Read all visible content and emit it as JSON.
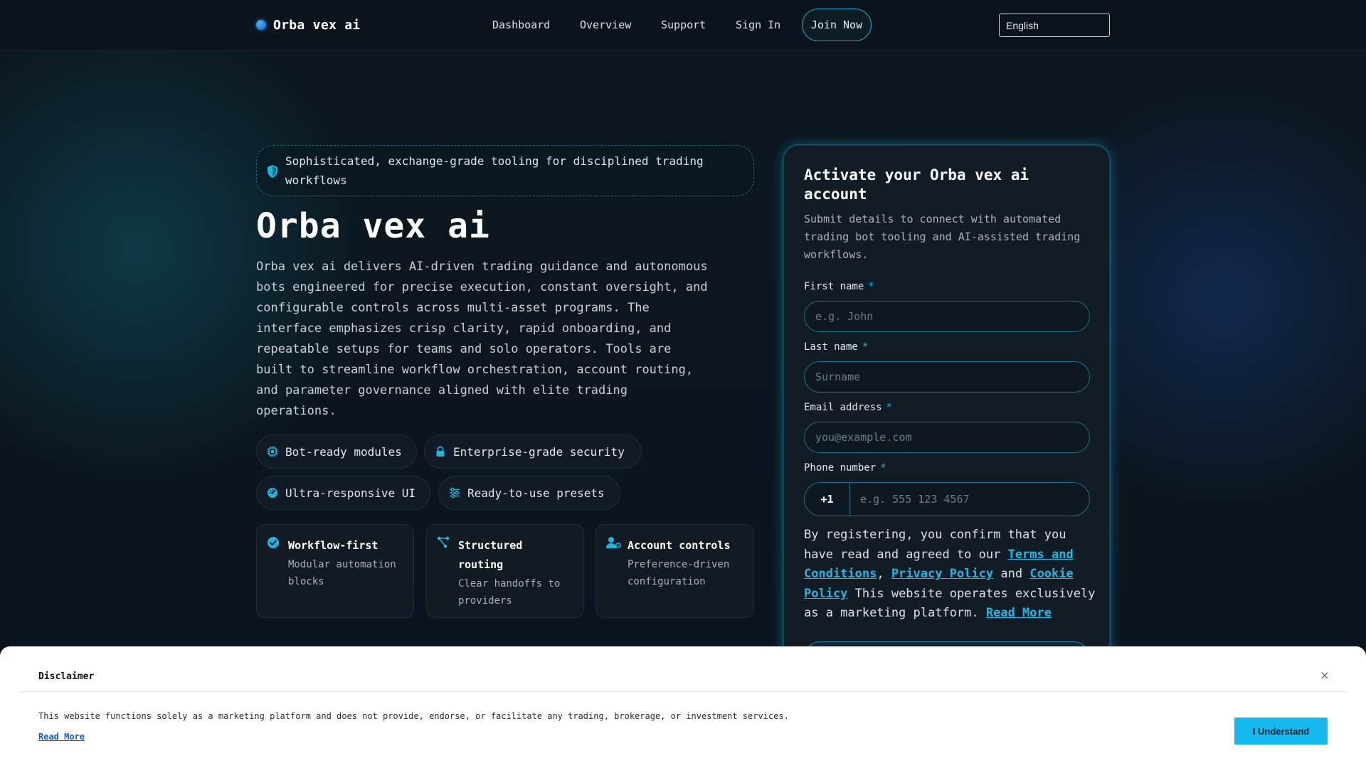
{
  "header": {
    "brand": "Orba vex ai",
    "nav": [
      "Dashboard",
      "Overview",
      "Support",
      "Sign In"
    ],
    "join_label": "Join Now",
    "language": "English"
  },
  "hero": {
    "eyebrow": "Sophisticated, exchange-grade tooling for disciplined trading workflows",
    "title": "Orba vex ai",
    "description": "Orba vex ai delivers AI-driven trading guidance and autonomous bots engineered for precise execution, constant oversight, and configurable controls across multi-asset programs. The interface emphasizes crisp clarity, rapid onboarding, and repeatable setups for teams and solo operators. Tools are built to streamline workflow orchestration, account routing, and parameter governance aligned with elite trading operations.",
    "pills": [
      {
        "label": "Bot-ready modules",
        "icon": "chip-icon"
      },
      {
        "label": "Enterprise-grade security",
        "icon": "lock-icon"
      },
      {
        "label": "Ultra-responsive UI",
        "icon": "gauge-icon"
      },
      {
        "label": "Ready-to-use presets",
        "icon": "sliders-icon"
      }
    ],
    "cards": [
      {
        "title": "Workflow-first",
        "subtitle": "Modular automation blocks",
        "icon": "check-circle-icon"
      },
      {
        "title": "Structured routing",
        "subtitle": "Clear handoffs to providers",
        "icon": "routing-icon"
      },
      {
        "title": "Account controls",
        "subtitle": "Preference-driven configuration",
        "icon": "user-settings-icon"
      }
    ]
  },
  "form": {
    "title": "Activate your Orba vex ai account",
    "description": "Submit details to connect with automated trading bot tooling and AI-assisted trading workflows.",
    "required_mark": "*",
    "first_name": {
      "label": "First name",
      "placeholder": "e.g. John"
    },
    "last_name": {
      "label": "Last name",
      "placeholder": "Surname"
    },
    "email": {
      "label": "Email address",
      "placeholder": "you@example.com"
    },
    "phone": {
      "label": "Phone number",
      "code": "+1",
      "placeholder": "e.g. 555 123 4567"
    },
    "consent": {
      "prefix": "By registering, you confirm that you have read and agreed to our ",
      "terms": "Terms and Conditions",
      "sep1": ", ",
      "privacy": "Privacy Policy",
      "sep2": " and ",
      "cookie": "Cookie Policy",
      "suffix": " This website operates exclusively as a marketing platform. ",
      "read_more": "Read More"
    }
  },
  "banner": {
    "title": "Disclaimer",
    "close": "×",
    "text": "This website functions solely as a marketing platform and does not provide, endorse, or facilitate any trading, brokerage, or investment services.",
    "read_more": "Read More",
    "button": "I Understand"
  },
  "colors": {
    "accent": "#13b9ef",
    "background": "#0b141c",
    "panel": "#111c25"
  }
}
